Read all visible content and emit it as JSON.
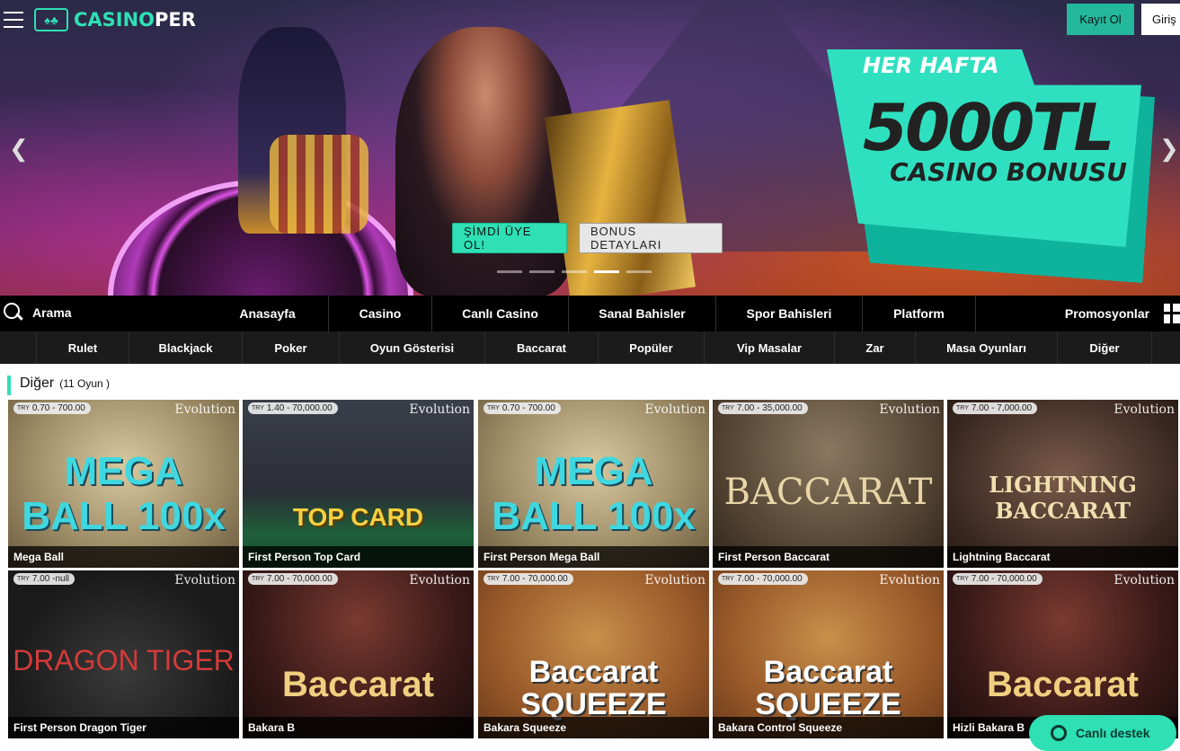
{
  "header": {
    "logo_casino": "CASINO",
    "logo_per": "PER",
    "register_label": "Kayıt Ol",
    "login_label": "Giriş"
  },
  "hero": {
    "promo_line1": "HER HAFTA",
    "promo_line2": "5000TL",
    "promo_line3": "CASINO BONUSU",
    "signup_label": "ŞİMDİ ÜYE OL!",
    "details_label": "BONUS DETAYLARI",
    "active_slide": 3,
    "slide_count": 5
  },
  "mainnav": {
    "search_label": "Arama",
    "items": [
      "Anasayfa",
      "Casino",
      "Canlı Casino",
      "Sanal Bahisler",
      "Spor Bahisleri",
      "Platform",
      "Promosyonlar"
    ]
  },
  "subnav": {
    "items": [
      "Rulet",
      "Blackjack",
      "Poker",
      "Oyun Gösterisi",
      "Baccarat",
      "Popüler",
      "Vip Masalar",
      "Zar",
      "Masa Oyunları",
      "Diğer"
    ]
  },
  "section": {
    "title": "Diğer",
    "count": "(11 Oyun )"
  },
  "games": [
    {
      "name": "Mega Ball",
      "limit": "0.70 - 700.00",
      "provider": "Evolution",
      "art": "MEGA BALL 100x"
    },
    {
      "name": "First Person Top Card",
      "limit": "1.40 - 70,000.00",
      "provider": "Evolution",
      "art": "TOP CARD"
    },
    {
      "name": "First Person Mega Ball",
      "limit": "0.70 - 700.00",
      "provider": "Evolution",
      "art": "MEGA BALL 100x"
    },
    {
      "name": "First Person Baccarat",
      "limit": "7.00 - 35,000.00",
      "provider": "Evolution",
      "art": "BACCARAT"
    },
    {
      "name": "Lightning Baccarat",
      "limit": "7.00 - 7,000.00",
      "provider": "Evolution",
      "art": "LIGHTNING BACCARAT"
    },
    {
      "name": "First Person Dragon Tiger",
      "limit": "7.00 -null",
      "provider": "Evolution",
      "art": "DRAGON TIGER"
    },
    {
      "name": "Bakara B",
      "limit": "7.00 - 70,000.00",
      "provider": "Evolution",
      "art": "Baccarat"
    },
    {
      "name": "Bakara Squeeze",
      "limit": "7.00 - 70,000.00",
      "provider": "Evolution",
      "art": "Baccarat SQUEEZE"
    },
    {
      "name": "Bakara Control Squeeze",
      "limit": "7.00 - 70,000.00",
      "provider": "Evolution",
      "art": "Baccarat SQUEEZE"
    },
    {
      "name": "Hizli Bakara B",
      "limit": "7.00 - 70,000.00",
      "provider": "Evolution",
      "art": "Baccarat"
    }
  ],
  "currency": "TRY",
  "chat": {
    "label": "Canlı destek"
  },
  "colors": {
    "accent": "#2ee0b4",
    "nav_bg": "#000000",
    "subnav_bg": "#1b1b1b"
  }
}
